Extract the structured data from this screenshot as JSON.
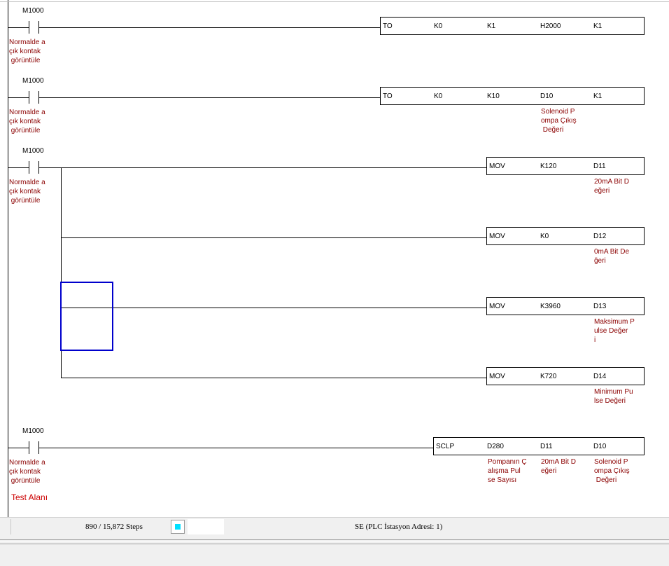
{
  "rungs": [
    {
      "contact": {
        "device": "M1000",
        "comment": "Normalde a\nçık kontak\n görüntüle"
      },
      "outputs": [
        {
          "cells": [
            "TO",
            "K0",
            "K1",
            "H2000",
            "K1"
          ],
          "notes": [
            "",
            "",
            "",
            "",
            ""
          ]
        }
      ]
    },
    {
      "contact": {
        "device": "M1000",
        "comment": "Normalde a\nçık kontak\n görüntüle"
      },
      "outputs": [
        {
          "cells": [
            "TO",
            "K0",
            "K10",
            "D10",
            "K1"
          ],
          "notes": [
            "",
            "",
            "",
            "Solenoid P\nompa Çıkış\n Değeri",
            ""
          ]
        }
      ]
    },
    {
      "contact": {
        "device": "M1000",
        "comment": "Normalde a\nçık kontak\n görüntüle"
      },
      "outputs": [
        {
          "cells": [
            "MOV",
            "K120",
            "D11"
          ],
          "notes": [
            "",
            "",
            "20mA Bit D\neğeri"
          ]
        },
        {
          "cells": [
            "MOV",
            "K0",
            "D12"
          ],
          "notes": [
            "",
            "",
            "0mA Bit De\nğeri"
          ]
        },
        {
          "cells": [
            "MOV",
            "K3960",
            "D13"
          ],
          "notes": [
            "",
            "",
            "Maksimum P\nulse Değer\ni"
          ]
        },
        {
          "cells": [
            "MOV",
            "K720",
            "D14"
          ],
          "notes": [
            "",
            "",
            "Minimum Pu\nlse Değeri"
          ]
        }
      ]
    },
    {
      "contact": {
        "device": "M1000",
        "comment": "Normalde a\nçık kontak\n görüntüle"
      },
      "outputs": [
        {
          "cells": [
            "SCLP",
            "D280",
            "D11",
            "D10"
          ],
          "notes": [
            "",
            "Pompanın Ç\nalışma Pul\nse Sayısı",
            "20mA Bit D\neğeri",
            "Solenoid P\nompa Çıkış\n Değeri"
          ]
        }
      ]
    }
  ],
  "rung_label": "Test Alanı",
  "status": {
    "steps": "890 / 15,872 Steps",
    "connection": "SE (PLC İstasyon Adresi: 1)",
    "indicator_color": "#00e0ff"
  },
  "colors": {
    "comment": "#8b0000",
    "test_label": "#cc0000",
    "cursor": "#0000cc"
  }
}
